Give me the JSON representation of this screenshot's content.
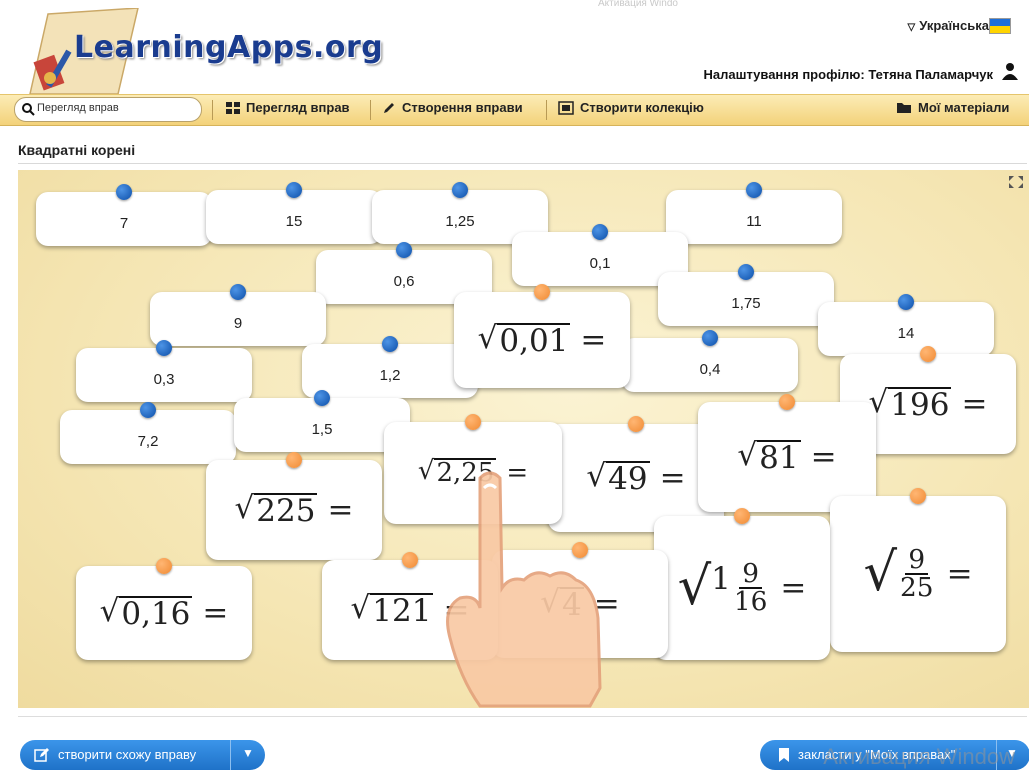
{
  "header": {
    "logo": "LearningApps.org",
    "watermark_top": "Активация Windo",
    "language": "Українська",
    "profile": "Налаштування профілю: Тетяна Паламарчук"
  },
  "toolbar": {
    "search_placeholder": "Перегляд вправ",
    "items": [
      "Перегляд вправ",
      "Створення вправи",
      "Створити колекцію",
      "Мої матеріали"
    ]
  },
  "page": {
    "title": "Квадратні корені"
  },
  "answers": [
    "7",
    "15",
    "1,25",
    "11",
    "0,1",
    "0,6",
    "1,75",
    "9",
    "14",
    "0,3",
    "1,2",
    "0,4",
    "7,2",
    "1,5"
  ],
  "expressions": {
    "e001": "0,01",
    "e196": "196",
    "e225": "225",
    "e225b": "2,25",
    "e49": "49",
    "e81": "81",
    "e016": "0,16",
    "e121": "121",
    "e_partial": "4",
    "mixed_whole": "1",
    "mixed_num": "9",
    "mixed_den": "16",
    "frac_num": "9",
    "frac_den": "25",
    "eq": "="
  },
  "footer": {
    "similar_button": "створити схожу вправу",
    "save_button": "закласти у \"Моїх вправах\"",
    "watermark": "Активация Window"
  },
  "colors": {
    "accent": "#1f72c8",
    "pin_blue": "#0c4ea8",
    "pin_orange": "#f08a33",
    "toolbar": "#f3d27a"
  }
}
